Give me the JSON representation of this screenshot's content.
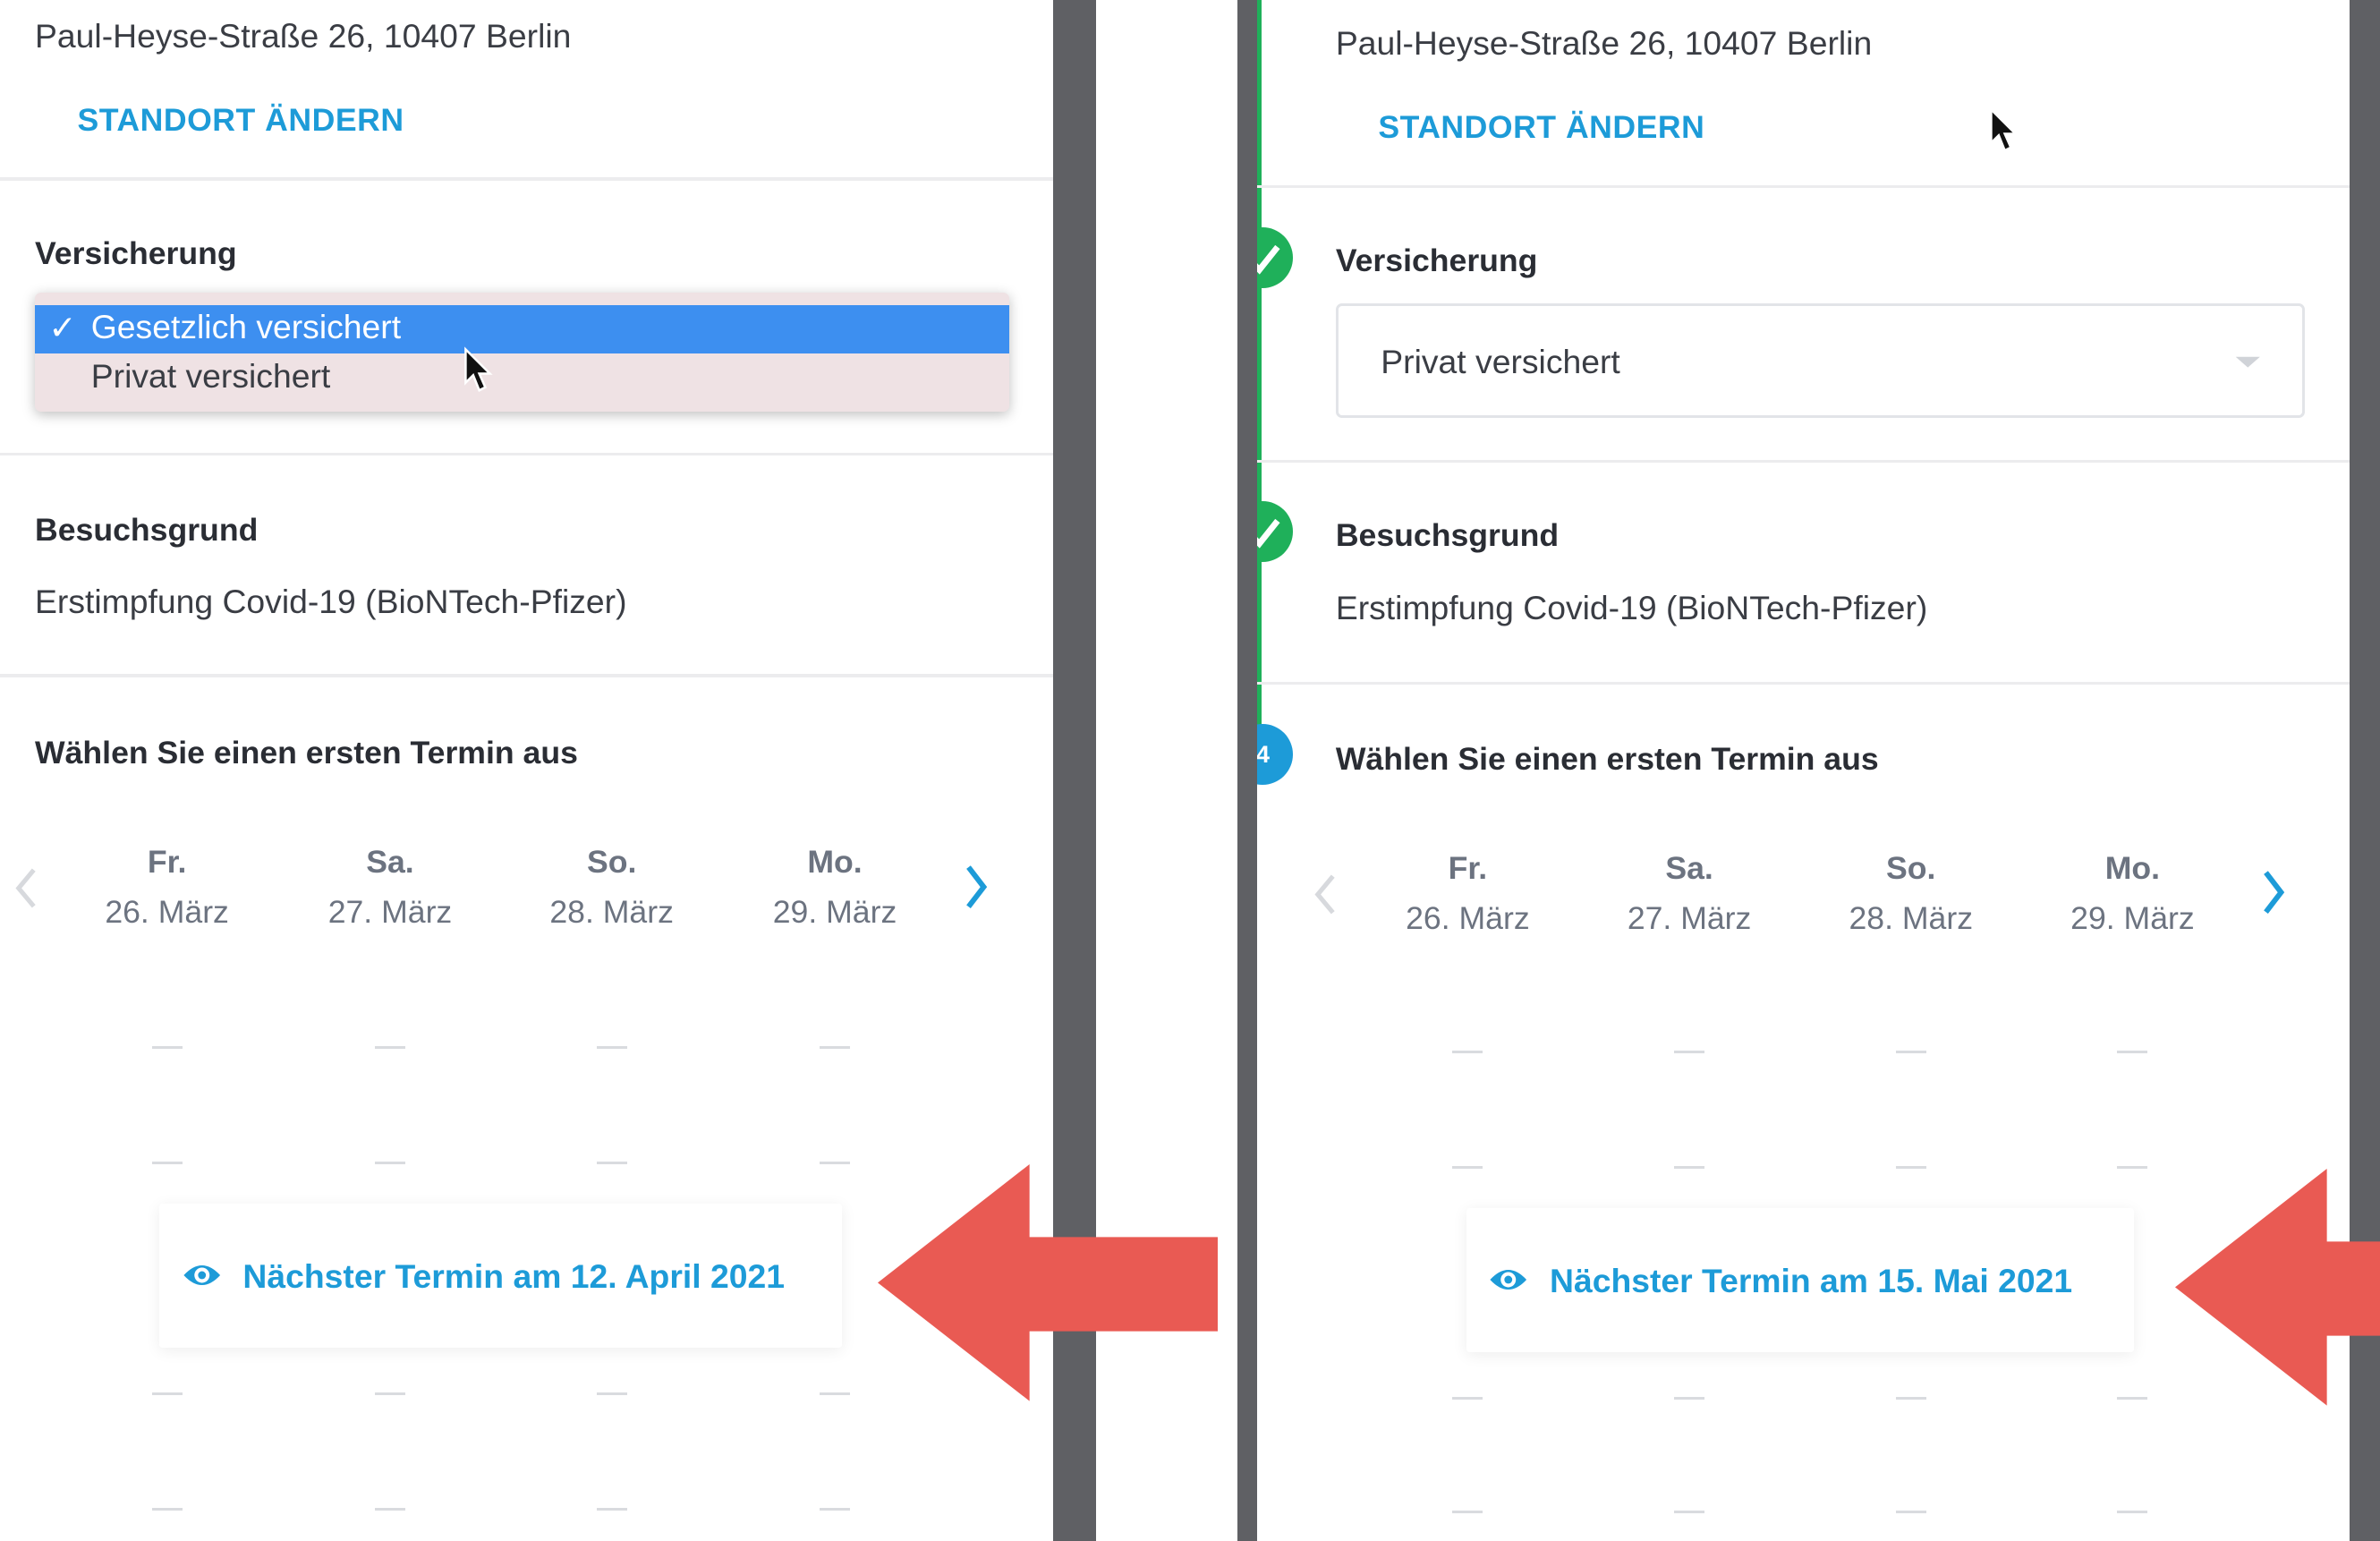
{
  "left": {
    "address": "Paul-Heyse-Straße 26, 10407 Berlin",
    "change_location": "STANDORT ÄNDERN",
    "insurance_title": "Versicherung",
    "insurance_options": [
      {
        "label": "Gesetzlich versichert",
        "selected": true
      },
      {
        "label": "Privat versichert",
        "selected": false
      }
    ],
    "checkmark": "✓",
    "reason_title": "Besuchsgrund",
    "reason_value": "Erstimpfung Covid-19 (BioNTech-Pfizer)",
    "appointment_title": "Wählen Sie einen ersten Termin aus",
    "days": [
      {
        "name": "Fr.",
        "date": "26. März"
      },
      {
        "name": "Sa.",
        "date": "27. März"
      },
      {
        "name": "So.",
        "date": "28. März"
      },
      {
        "name": "Mo.",
        "date": "29. März"
      }
    ],
    "next_appointment": "Nächster Termin am 12. April 2021"
  },
  "right": {
    "address": "Paul-Heyse-Straße 26, 10407 Berlin",
    "change_location": "STANDORT ÄNDERN",
    "insurance_title": "Versicherung",
    "insurance_selected": "Privat versichert",
    "reason_title": "Besuchsgrund",
    "reason_value": "Erstimpfung Covid-19 (BioNTech-Pfizer)",
    "step_number": "4",
    "appointment_title": "Wählen Sie einen ersten Termin aus",
    "days": [
      {
        "name": "Fr.",
        "date": "26. März"
      },
      {
        "name": "Sa.",
        "date": "27. März"
      },
      {
        "name": "So.",
        "date": "28. März"
      },
      {
        "name": "Mo.",
        "date": "29. März"
      }
    ],
    "next_appointment": "Nächster Termin am 15. Mai 2021"
  },
  "colors": {
    "accent_blue": "#1d9bd8",
    "selection_blue": "#3d8ff0",
    "success_green": "#1fb05a",
    "arrow_red": "#e95a53",
    "gutter_gray": "#5f6064"
  },
  "icons": [
    "eye-icon",
    "chevron-left-icon",
    "chevron-right-icon",
    "check-icon",
    "dropdown-caret-icon",
    "mouse-cursor-icon",
    "red-arrow-icon"
  ]
}
